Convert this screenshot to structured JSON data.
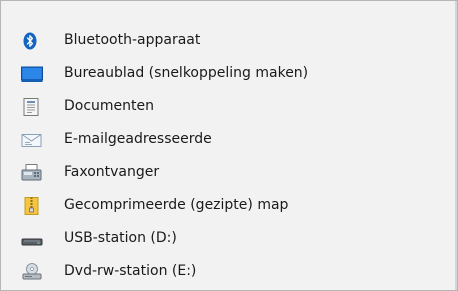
{
  "menu": {
    "items": [
      {
        "label": "Bluetooth-apparaat",
        "icon": "bluetooth-icon"
      },
      {
        "label": "Bureaublad (snelkoppeling maken)",
        "icon": "desktop-icon"
      },
      {
        "label": "Documenten",
        "icon": "documents-icon"
      },
      {
        "label": "E-mailgeadresseerde",
        "icon": "mail-recipient-icon"
      },
      {
        "label": "Faxontvanger",
        "icon": "fax-icon"
      },
      {
        "label": "Gecomprimeerde (gezipte) map",
        "icon": "zip-folder-icon"
      },
      {
        "label": "USB-station (D:)",
        "icon": "usb-drive-icon"
      },
      {
        "label": "Dvd-rw-station (E:)",
        "icon": "dvd-drive-icon"
      }
    ]
  },
  "colors": {
    "menu_background": "#f2f2f2",
    "border": "#b6b6b6",
    "bluetooth_blue": "#1565c0",
    "desktop_blue": "#1a73d8",
    "folder_yellow": "#f5c542"
  }
}
